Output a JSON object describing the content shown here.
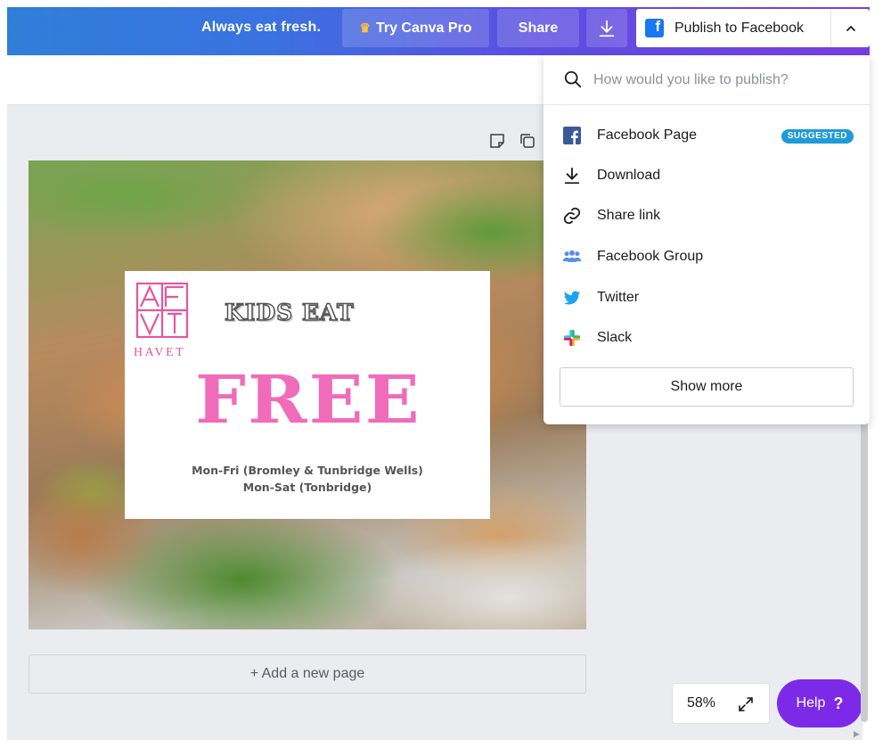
{
  "topbar": {
    "tagline": "Always eat fresh.",
    "try_pro_label": "Try Canva Pro",
    "share_label": "Share",
    "publish_label": "Publish to Facebook",
    "gradient_start": "#2f7fd8",
    "gradient_end": "#7a3ee0"
  },
  "publish_menu": {
    "search_placeholder": "How would you like to publish?",
    "items": [
      {
        "label": "Facebook Page",
        "icon": "facebook-icon",
        "badge": "SUGGESTED"
      },
      {
        "label": "Download",
        "icon": "download-icon"
      },
      {
        "label": "Share link",
        "icon": "link-icon"
      },
      {
        "label": "Facebook Group",
        "icon": "group-icon"
      },
      {
        "label": "Twitter",
        "icon": "twitter-icon"
      },
      {
        "label": "Slack",
        "icon": "slack-icon"
      }
    ],
    "show_more_label": "Show more"
  },
  "design": {
    "logo_word": "HAVET",
    "headline": "KIDS EAT",
    "big_word": "FREE",
    "details": "Mon-Fri (Bromley & Tunbridge Wells) Mon-Sat (Tonbridge)",
    "pink": "#f06cba"
  },
  "editor": {
    "add_page_label": "+ Add a new page",
    "zoom": "58%",
    "help_label": "Help",
    "help_symbol": "?"
  },
  "colors": {
    "help_purple": "#7d2ae8",
    "suggested_badge": "#1f9bd7",
    "facebook_blue": "#1877f2"
  }
}
